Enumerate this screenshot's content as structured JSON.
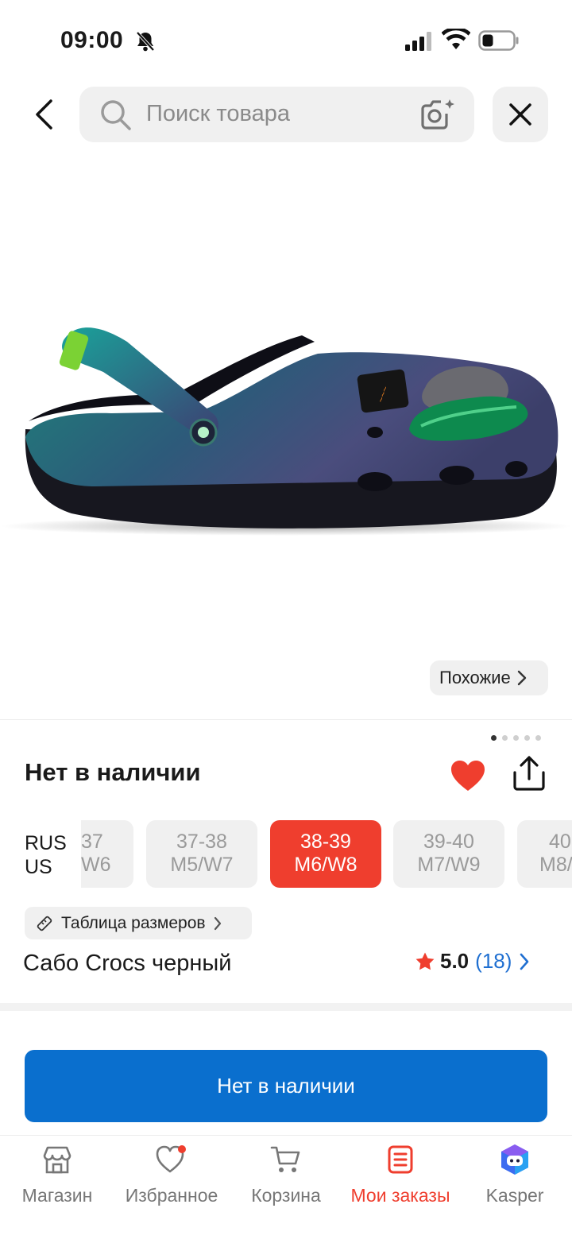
{
  "status_bar": {
    "time": "09:00"
  },
  "header": {
    "search_placeholder": "Поиск товара"
  },
  "product_image": {
    "similar_label": "Похожие",
    "page_count": 5,
    "active_page": 1
  },
  "availability": {
    "title": "Нет в наличии"
  },
  "sizes": {
    "systems": [
      "RUS",
      "US"
    ],
    "options": [
      {
        "rus": "37",
        "us": "W6",
        "selected": false
      },
      {
        "rus": "37-38",
        "us": "M5/W7",
        "selected": false
      },
      {
        "rus": "38-39",
        "us": "M6/W8",
        "selected": true
      },
      {
        "rus": "39-40",
        "us": "M7/W9",
        "selected": false
      },
      {
        "rus": "40",
        "us": "M8/",
        "selected": false
      }
    ],
    "table_label": "Таблица размеров"
  },
  "product": {
    "name": "Сабо Crocs черный",
    "rating": "5.0",
    "reviews": "(18)"
  },
  "buy_button": {
    "label": "Нет в наличии"
  },
  "tabbar": {
    "items": [
      {
        "label": "Магазин",
        "icon": "shop-icon",
        "active": false
      },
      {
        "label": "Избранное",
        "icon": "heart-icon",
        "active": false
      },
      {
        "label": "Корзина",
        "icon": "cart-icon",
        "active": false
      },
      {
        "label": "Мои заказы",
        "icon": "orders-icon",
        "active": true
      },
      {
        "label": "Kasper",
        "icon": "kasper-icon",
        "active": false
      }
    ]
  },
  "colors": {
    "accent_red": "#ef3e2e",
    "primary_blue": "#0a6fce",
    "link_blue": "#1f6fd1"
  }
}
